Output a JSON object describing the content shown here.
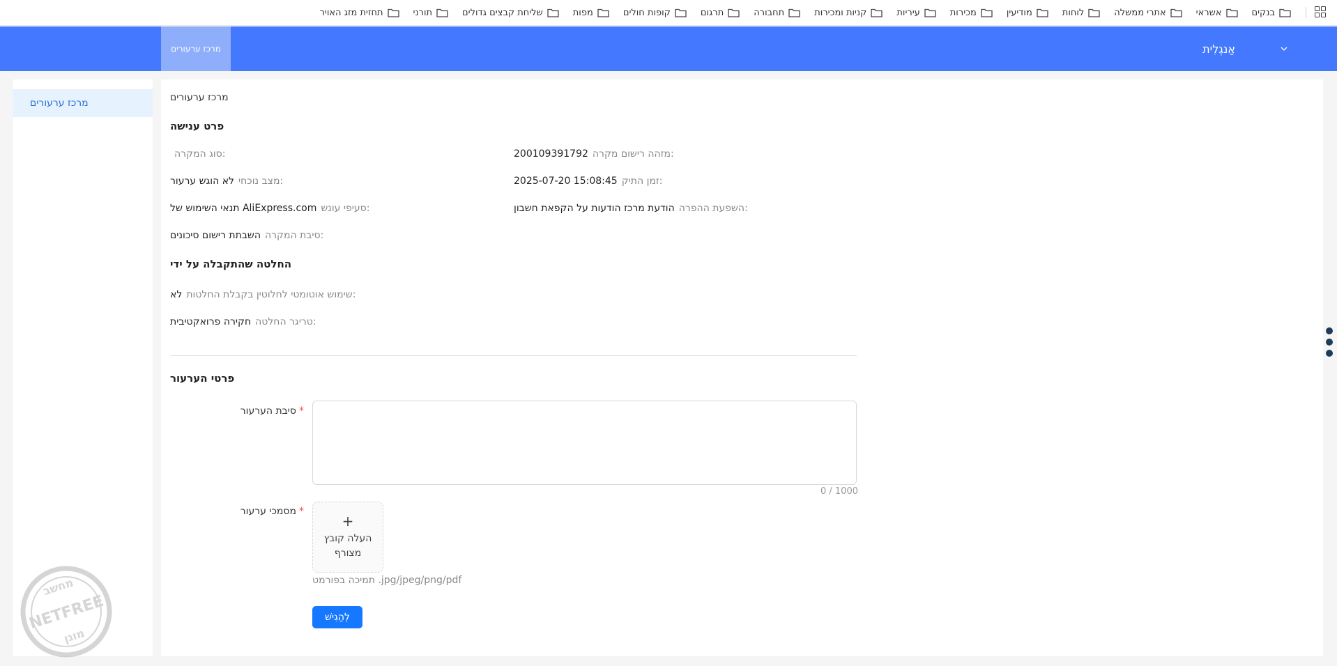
{
  "bookmarks": [
    {
      "label": "בנקים"
    },
    {
      "label": "אשראי"
    },
    {
      "label": "אתרי ממשלה"
    },
    {
      "label": "לוחות"
    },
    {
      "label": "מודיעין"
    },
    {
      "label": "מכירות"
    },
    {
      "label": "עיריות"
    },
    {
      "label": "קניות ומכירות"
    },
    {
      "label": "תחבורה"
    },
    {
      "label": "תרגום"
    },
    {
      "label": "קופות חולים"
    },
    {
      "label": "מפות"
    },
    {
      "label": "שליחת קבצים גדולים"
    },
    {
      "label": "תורני"
    },
    {
      "label": "תחזית מזג האויר"
    }
  ],
  "header": {
    "tab_label": "מרכז ערעורים",
    "language": "אַנגְלִית"
  },
  "sidebar": {
    "items": [
      {
        "label": "מרכז ערעורים"
      }
    ]
  },
  "main": {
    "breadcrumb": "מרכז ערעורים",
    "penalty_section": {
      "title": "פרט ענישה",
      "fields": {
        "incident_id": {
          "label": "מזהה רישום מקרה:",
          "value": "200109391792"
        },
        "incident_type": {
          "label": "סוג המקרה:",
          "value": ""
        },
        "case_time": {
          "label": "זמן התיק:",
          "value": "2025-07-20 15:08:45"
        },
        "current_status": {
          "label": "מצב נוכחי:",
          "value": "לא הוגש ערעור"
        },
        "violation_impact": {
          "label": "השפעת ההפרה:",
          "value": "הודעת מרכז הודעות על הקפאת חשבון"
        },
        "penalty_clauses": {
          "label": "סעיפי עונש:",
          "value": "תנאי השימוש של AliExpress.com"
        },
        "incident_reason": {
          "label": "סיבת המקרה:",
          "value": "השבתת רישום סיכונים"
        }
      }
    },
    "decision_section": {
      "title": "החלטה שהתקבלה על ידי",
      "fields": {
        "automated": {
          "label": "שימוש אוטומטי לחלוטין בקבלת החלטות:",
          "value": "לא"
        },
        "trigger": {
          "label": "טריגר החלטה:",
          "value": "חקירה פרואקטיבית"
        }
      }
    },
    "appeal_section": {
      "title": "פרטי הערעור",
      "reason_label": "סיבת הערעור",
      "reason_value": "",
      "char_counter": "0 / 1000",
      "docs_label": "מסמכי ערעור",
      "upload_plus": "+",
      "upload_label": "העלה קובץ מצורף",
      "format_hint": "תמיכה בפורמט .jpg/jpeg/png/pdf",
      "submit_label": "לְהַגִישׁ",
      "required_mark": "*"
    }
  },
  "watermark": {
    "text_top": "מחשב",
    "text_mid": "NETFREE",
    "text_bottom": "מוגן"
  },
  "colors": {
    "header": "#4479ff",
    "primary": "#1677ff",
    "sidebar_active_bg": "#e7f2ff"
  }
}
